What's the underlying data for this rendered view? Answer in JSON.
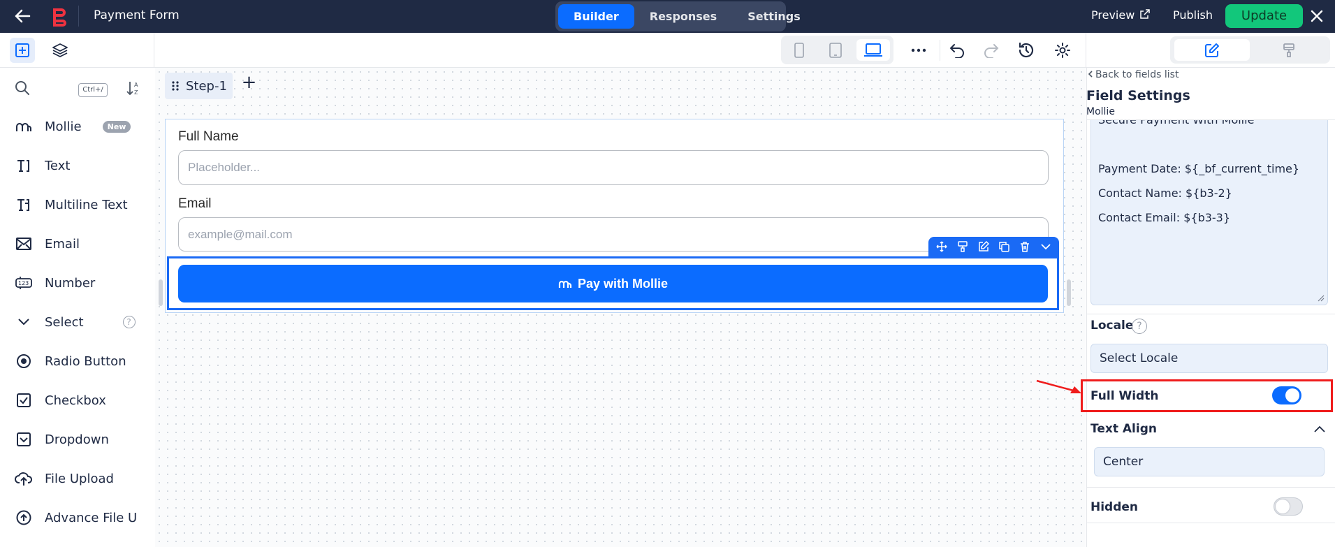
{
  "topbar": {
    "title": "Payment Form",
    "tabs": [
      {
        "label": "Builder",
        "active": true
      },
      {
        "label": "Responses",
        "active": false
      },
      {
        "label": "Settings",
        "active": false
      }
    ],
    "preview": "Preview",
    "publish": "Publish",
    "update": "Update",
    "colors": {
      "bg": "#1f2a44",
      "accent": "#0b6cff",
      "update": "#12c77b"
    }
  },
  "sidebar": {
    "search_placeholder": "",
    "shortcut": "Ctrl+/",
    "items": [
      {
        "label": "Mollie",
        "icon": "mollie-icon",
        "badge": "New"
      },
      {
        "label": "Text",
        "icon": "text-field-icon"
      },
      {
        "label": "Multiline Text",
        "icon": "multiline-text-icon"
      },
      {
        "label": "Email",
        "icon": "envelope-icon"
      },
      {
        "label": "Number",
        "icon": "number-icon"
      },
      {
        "label": "Select",
        "icon": "chevron-down-icon",
        "help": "?"
      },
      {
        "label": "Radio Button",
        "icon": "radio-icon"
      },
      {
        "label": "Checkbox",
        "icon": "checkbox-icon"
      },
      {
        "label": "Dropdown",
        "icon": "dropdown-icon"
      },
      {
        "label": "File Upload",
        "icon": "upload-icon"
      },
      {
        "label": "Advance File U",
        "icon": "advance-upload-icon"
      }
    ]
  },
  "canvas": {
    "step_label": "Step-1",
    "add_step": "+",
    "fields": [
      {
        "label": "Full Name",
        "placeholder": "Placeholder..."
      },
      {
        "label": "Email",
        "placeholder": "example@mail.com"
      }
    ],
    "pay_button": "Pay with Mollie"
  },
  "right_panel": {
    "back": "Back to fields list",
    "title": "Field Settings",
    "subtitle": "Mollie",
    "description_lines": [
      "Secure Payment With Mollie",
      "",
      "Payment Date: ${_bf_current_time}",
      "Contact Name: ${b3-2}",
      "Contact Email: ${b3-3}"
    ],
    "locale_label": "Locale",
    "locale_help": "?",
    "locale_value": "Select Locale",
    "full_width_label": "Full Width",
    "full_width_on": true,
    "text_align_label": "Text Align",
    "text_align_value": "Center",
    "hidden_label": "Hidden",
    "hidden_on": false
  }
}
